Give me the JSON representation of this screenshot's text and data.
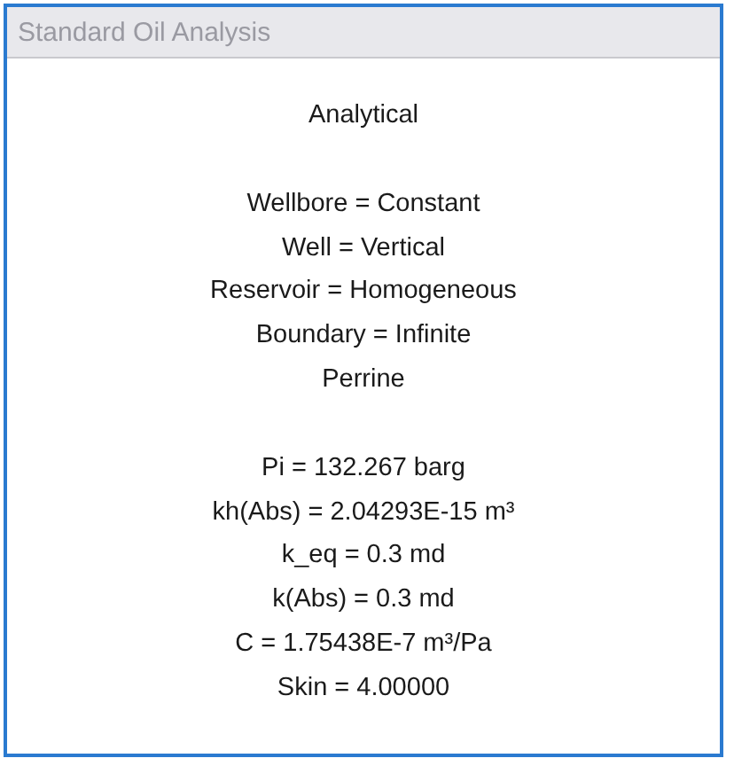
{
  "window": {
    "title": "Standard Oil Analysis"
  },
  "groups": [
    [
      "Analytical"
    ],
    [
      "Wellbore = Constant",
      "Well = Vertical",
      "Reservoir = Homogeneous",
      "Boundary = Infinite",
      "Perrine"
    ],
    [
      "Pi = 132.267 barg",
      "kh(Abs) = 2.04293E-15 m³",
      "k_eq = 0.3 md",
      "k(Abs) = 0.3 md",
      "C = 1.75438E-7 m³/Pa",
      "Skin = 4.00000"
    ]
  ]
}
